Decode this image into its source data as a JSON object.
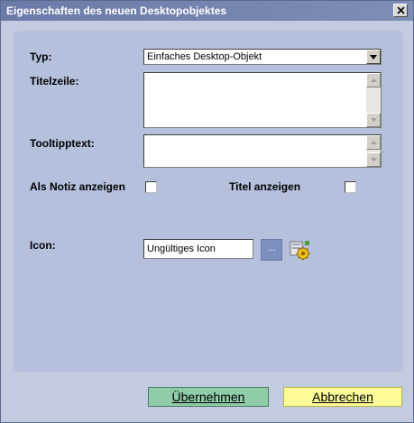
{
  "window": {
    "title": "Eigenschaften des neuen Desktopobjektes"
  },
  "form": {
    "type_label": "Typ:",
    "type_value": "Einfaches Desktop-Objekt",
    "title_label": "Titelzeile:",
    "title_value": "",
    "tooltip_label": "Tooltipptext:",
    "tooltip_value": "",
    "note_label": "Als Notiz anzeigen",
    "note_checked": false,
    "show_title_label": "Titel anzeigen",
    "show_title_checked": false,
    "icon_label": "Icon:",
    "icon_value": "Ungültiges Icon",
    "browse_label": "..."
  },
  "buttons": {
    "apply_label": "Übernehmen",
    "cancel_label": "Abbrechen"
  },
  "colors": {
    "titlebar": "#7381ae",
    "window_bg": "#c3cbe0",
    "panel_bg": "#b4c0dc",
    "apply_bg": "#8fcca8",
    "cancel_bg": "#fbfb98"
  }
}
